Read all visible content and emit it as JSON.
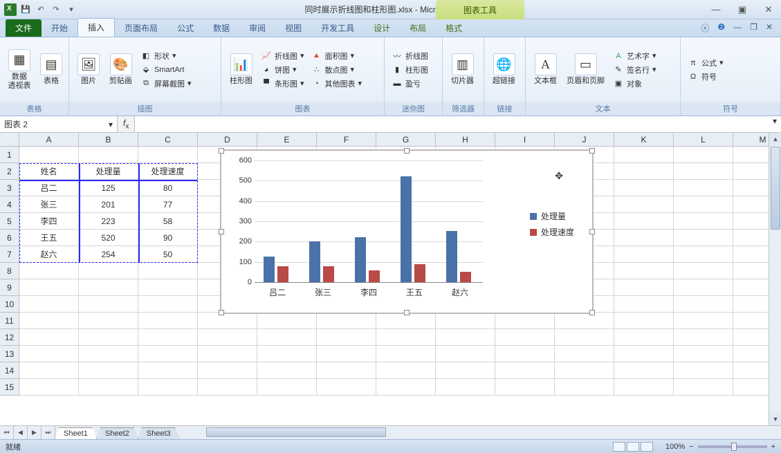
{
  "title": "同时展示折线图和柱形图.xlsx - Microsoft Excel",
  "chart_tools_label": "图表工具",
  "tabs": {
    "file": "文件",
    "home": "开始",
    "insert": "插入",
    "layout": "页面布局",
    "formulas": "公式",
    "data": "数据",
    "review": "审阅",
    "view": "视图",
    "dev": "开发工具",
    "design": "设计",
    "layout2": "布局",
    "format": "格式"
  },
  "ribbon": {
    "groups": {
      "tables": "表格",
      "illustrations": "插图",
      "charts": "图表",
      "sparklines": "迷你图",
      "filter": "筛选器",
      "links": "链接",
      "text": "文本",
      "symbols": "符号"
    },
    "pivot": "数据\n透视表",
    "table": "表格",
    "picture": "图片",
    "clipart": "剪贴画",
    "shapes": "形状",
    "smartart": "SmartArt",
    "screenshot": "屏幕截图",
    "column": "柱形图",
    "line": "折线图",
    "pie": "饼图",
    "bar": "条形图",
    "area": "面积图",
    "scatter": "散点图",
    "other": "其他图表",
    "spark_line": "折线图",
    "spark_col": "柱形图",
    "spark_wl": "盈亏",
    "slicer": "切片器",
    "hyperlink": "超链接",
    "textbox": "文本框",
    "headerfooter": "页眉和页脚",
    "wordart": "艺术字",
    "sigline": "签名行",
    "object": "对象",
    "equation": "公式",
    "symbol": "符号"
  },
  "namebox": "图表 2",
  "columns": [
    "A",
    "B",
    "C",
    "D",
    "E",
    "F",
    "G",
    "H",
    "I",
    "J",
    "K",
    "L",
    "M"
  ],
  "rows": [
    "1",
    "2",
    "3",
    "4",
    "5",
    "6",
    "7",
    "8",
    "9",
    "10",
    "11",
    "12",
    "13",
    "14",
    "15"
  ],
  "table": {
    "headers": [
      "姓名",
      "处理量",
      "处理速度"
    ],
    "rows": [
      [
        "吕二",
        "125",
        "80"
      ],
      [
        "张三",
        "201",
        "77"
      ],
      [
        "李四",
        "223",
        "58"
      ],
      [
        "王五",
        "520",
        "90"
      ],
      [
        "赵六",
        "254",
        "50"
      ]
    ]
  },
  "sheets": [
    "Sheet1",
    "Sheet2",
    "Sheet3"
  ],
  "status_text": "就绪",
  "zoom": "100%",
  "chart_data": {
    "type": "bar",
    "categories": [
      "吕二",
      "张三",
      "李四",
      "王五",
      "赵六"
    ],
    "series": [
      {
        "name": "处理量",
        "color": "#4a72a8",
        "values": [
          125,
          201,
          223,
          520,
          254
        ]
      },
      {
        "name": "处理速度",
        "color": "#b84a48",
        "values": [
          80,
          77,
          58,
          90,
          50
        ]
      }
    ],
    "ylim": [
      0,
      600
    ],
    "ytick": 100,
    "y_ticks": [
      0,
      100,
      200,
      300,
      400,
      500,
      600
    ]
  }
}
